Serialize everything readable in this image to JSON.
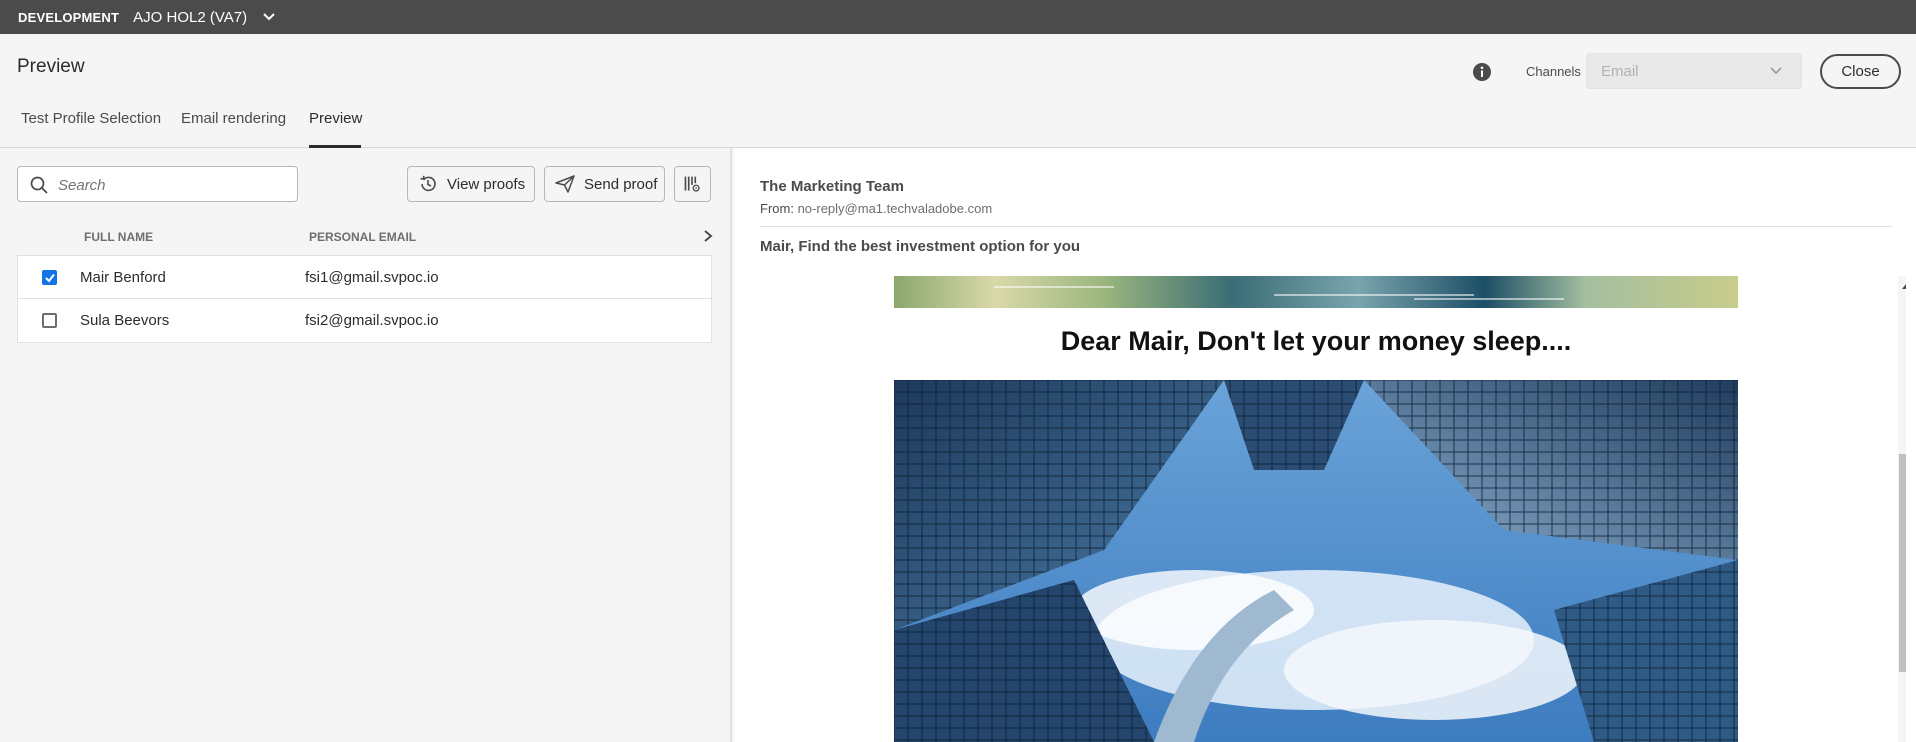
{
  "env": {
    "label": "DEVELOPMENT",
    "sandbox": "AJO HOL2 (VA7)"
  },
  "header": {
    "title": "Preview",
    "channels_label": "Channels",
    "channel_value": "Email",
    "close_label": "Close"
  },
  "tabs": [
    {
      "label": "Test Profile Selection"
    },
    {
      "label": "Email rendering"
    },
    {
      "label": "Preview"
    }
  ],
  "left": {
    "search_placeholder": "Search",
    "view_proofs": "View proofs",
    "send_proof": "Send proof",
    "columns": [
      "FULL NAME",
      "PERSONAL EMAIL"
    ],
    "rows": [
      {
        "name": "Mair Benford",
        "email": "fsi1@gmail.svpoc.io",
        "checked": true
      },
      {
        "name": "Sula Beevors",
        "email": "fsi2@gmail.svpoc.io",
        "checked": false
      }
    ]
  },
  "preview": {
    "sender": "The Marketing Team",
    "from_label": "From:",
    "from_address": "no-reply@ma1.techvaladobe.com",
    "subject": "Mair, Find the best investment option for you",
    "headline": "Dear Mair, Don't let your money sleep...."
  },
  "colors": {
    "accent": "#1473e6",
    "envbar": "#4b4b4b"
  }
}
